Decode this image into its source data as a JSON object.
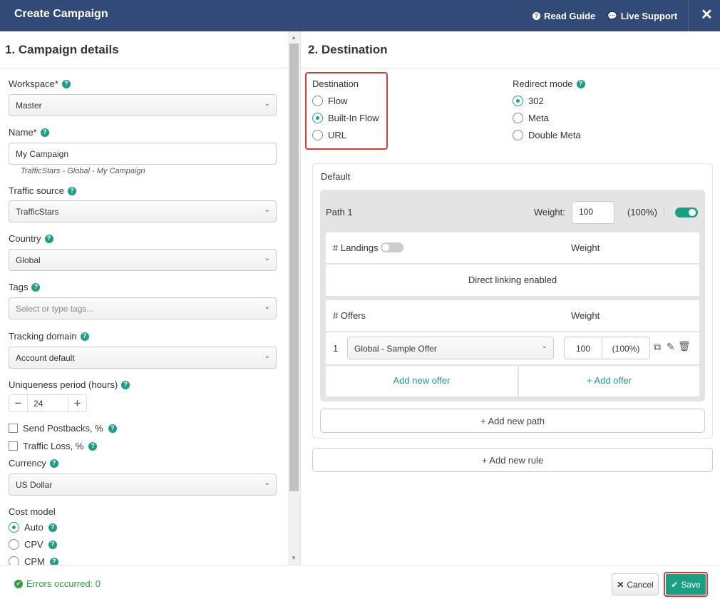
{
  "header": {
    "title": "Create Campaign",
    "read_guide": "Read Guide",
    "live_support": "Live Support",
    "close_icon": "✕"
  },
  "details": {
    "title": "1. Campaign details",
    "workspace": {
      "label": "Workspace*",
      "value": "Master"
    },
    "name": {
      "label": "Name*",
      "value": "My Campaign",
      "hint": "TrafficStars - Global - My Campaign"
    },
    "traffic_source": {
      "label": "Traffic source",
      "value": "TrafficStars"
    },
    "country": {
      "label": "Country",
      "value": "Global"
    },
    "tags": {
      "label": "Tags",
      "placeholder": "Select or type tags..."
    },
    "tracking_domain": {
      "label": "Tracking domain",
      "value": "Account default"
    },
    "uniqueness": {
      "label": "Uniqueness period (hours)",
      "value": "24",
      "minus": "−",
      "plus": "+"
    },
    "send_postbacks": {
      "label": "Send Postbacks, %",
      "checked": false
    },
    "traffic_loss": {
      "label": "Traffic Loss, %",
      "checked": false
    },
    "currency": {
      "label": "Currency",
      "value": "US Dollar"
    },
    "cost_model": {
      "label": "Cost model",
      "options": [
        {
          "label": "Auto",
          "selected": true
        },
        {
          "label": "CPV",
          "selected": false
        },
        {
          "label": "CPM",
          "selected": false
        }
      ]
    }
  },
  "destination": {
    "title": "2. Destination",
    "dest_group": {
      "label": "Destination",
      "options": [
        {
          "label": "Flow",
          "selected": false
        },
        {
          "label": "Built-In Flow",
          "selected": true
        },
        {
          "label": "URL",
          "selected": false
        }
      ]
    },
    "redirect_group": {
      "label": "Redirect mode",
      "options": [
        {
          "label": "302",
          "selected": true
        },
        {
          "label": "Meta",
          "selected": false
        },
        {
          "label": "Double Meta",
          "selected": false
        }
      ]
    },
    "default_label": "Default",
    "path": {
      "name": "Path 1",
      "weight_label": "Weight:",
      "weight": "100",
      "percent": "(100%)",
      "enabled": true,
      "landings_label": "# Landings",
      "landings_enabled": false,
      "weight_header": "Weight",
      "direct_linking": "Direct linking enabled",
      "offers_label": "# Offers",
      "offers": [
        {
          "index": "1",
          "name": "Global - Sample Offer",
          "weight": "100",
          "percent": "(100%)"
        }
      ],
      "add_new_offer": "Add new offer",
      "add_offer": "+ Add offer"
    },
    "add_new_path": "+ Add new path",
    "add_new_rule": "+ Add new rule"
  },
  "footer": {
    "errors": "Errors occurred: 0",
    "cancel": "Cancel",
    "save": "Save"
  },
  "colors": {
    "header_bg": "#324a77",
    "accent": "#1a9e84",
    "highlight": "#d9393b",
    "success": "#2e9e3e"
  }
}
